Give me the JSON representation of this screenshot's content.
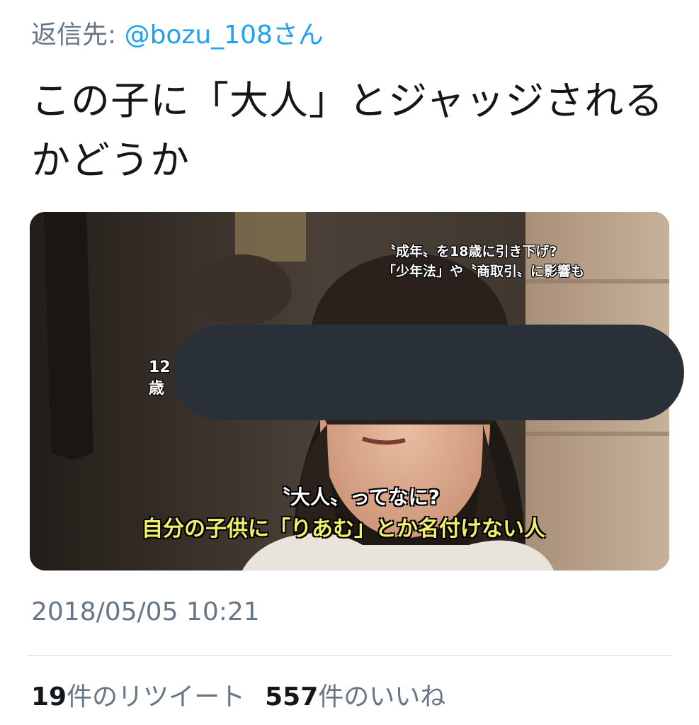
{
  "reply": {
    "prefix": "返信先: ",
    "handle": "@bozu_108さん"
  },
  "tweet": {
    "text": "この子に「大人」とジャッジされるかどうか"
  },
  "media": {
    "captions": {
      "top_line1": "〝成年〟を18歳に引き下げ?",
      "top_line2": "「少年法」や〝商取引〟に影響も",
      "age_line1": "12",
      "age_line2": "歳",
      "question": "〝大人〟ってなに?",
      "answer": "自分の子供に「りあむ」とか名付けない人"
    }
  },
  "timestamp": "2018/05/05 10:21",
  "stats": {
    "retweets_count": "19",
    "retweets_label": "件のリツイート",
    "likes_count": "557",
    "likes_label": "件のいいね"
  },
  "colors": {
    "secondary_text": "#657786",
    "link": "#1da1f2",
    "primary_text": "#14171a",
    "redaction": "#2a3038",
    "caption_yellow": "#f3ef6a"
  }
}
